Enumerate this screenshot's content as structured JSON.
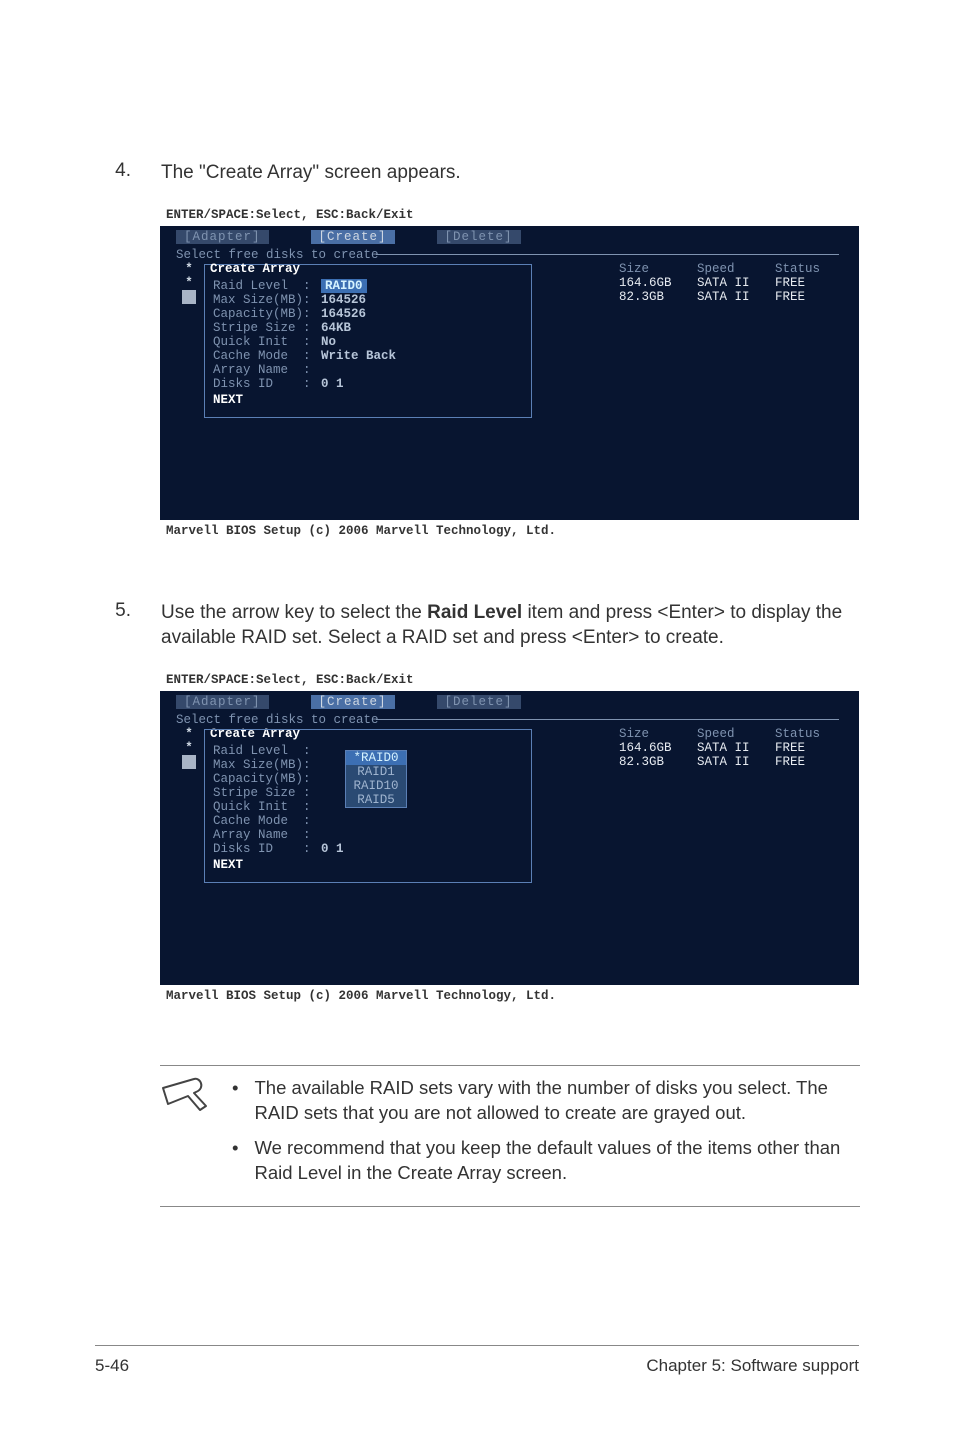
{
  "step4": {
    "num": "4.",
    "text": "The \"Create Array\" screen appears."
  },
  "step5": {
    "num": "5.",
    "text_parts": {
      "a": "Use the arrow key to select the ",
      "b": "Raid Level",
      "c": " item and press <Enter> to display the available RAID set. Select a RAID set and press <Enter> to create."
    }
  },
  "bios_common": {
    "top": "ENTER/SPACE:Select, ESC:Back/Exit",
    "tabs": {
      "adapter": "[Adapter]",
      "create": "[Create]",
      "delete": "[Delete]"
    },
    "subhdr": "Select free disks to create",
    "foot": "Marvell BIOS Setup (c) 2006 Marvell Technology, Ltd.",
    "disk_headers": {
      "size": "Size",
      "speed": "Speed",
      "status": "Status"
    },
    "disks": [
      {
        "size": "164.6GB",
        "speed": "SATA II",
        "status": "FREE"
      },
      {
        "size": "82.3GB",
        "speed": "SATA II",
        "status": "FREE"
      }
    ]
  },
  "bios1_panel": {
    "title": "Create Array",
    "rows": {
      "raid_level": {
        "label": "Raid Level  :",
        "value": "RAID0"
      },
      "max_size": {
        "label": "Max Size(MB):",
        "value": "164526"
      },
      "capacity": {
        "label": "Capacity(MB):",
        "value": "164526"
      },
      "stripe_size": {
        "label": "Stripe Size :",
        "value": "64KB"
      },
      "quick_init": {
        "label": "Quick Init  :",
        "value": "No"
      },
      "cache_mode": {
        "label": "Cache Mode  :",
        "value": "Write Back"
      },
      "array_name": {
        "label": "Array Name  :",
        "value": ""
      },
      "disks_id": {
        "label": "Disks ID    :",
        "value": "0 1"
      }
    },
    "next": "NEXT"
  },
  "bios2_panel": {
    "title": "Create Array",
    "rows": {
      "raid_level": {
        "label": "Raid Level  :",
        "value": ""
      },
      "max_size": {
        "label": "Max Size(MB):",
        "value": ""
      },
      "capacity": {
        "label": "Capacity(MB):",
        "value": ""
      },
      "stripe_size": {
        "label": "Stripe Size :",
        "value": ""
      },
      "quick_init": {
        "label": "Quick Init  :",
        "value": ""
      },
      "cache_mode": {
        "label": "Cache Mode  :",
        "value": ""
      },
      "array_name": {
        "label": "Array Name  :",
        "value": ""
      },
      "disks_id": {
        "label": "Disks ID    :",
        "value": "0 1"
      }
    },
    "next": "NEXT",
    "options": {
      "o1": "*RAID0",
      "o2": "RAID1",
      "o3": "RAID10",
      "o4": "RAID5"
    }
  },
  "notes": {
    "n1": "The available RAID sets vary with the number of disks you select. The RAID sets that you are not allowed to create are grayed out.",
    "n2": "We recommend that you keep the default values of the items other than Raid Level in the Create Array screen."
  },
  "footer": {
    "left": "5-46",
    "right": "Chapter 5: Software support"
  }
}
